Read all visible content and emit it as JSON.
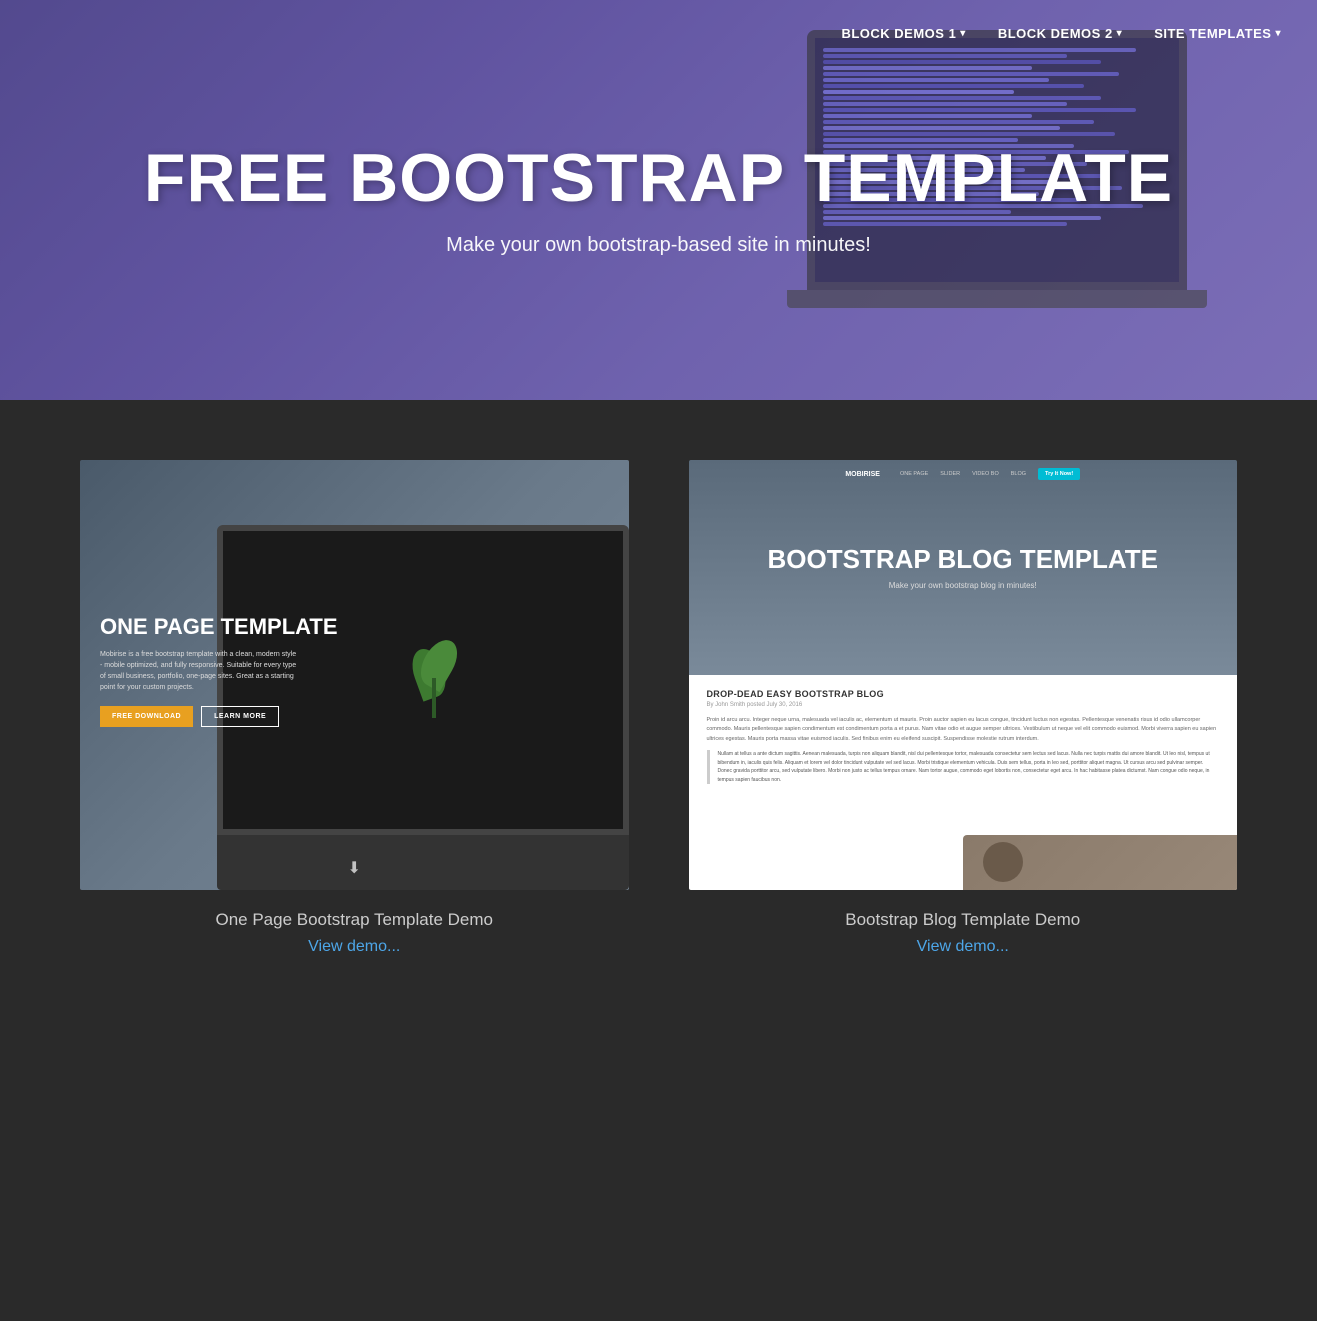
{
  "navbar": {
    "items": [
      {
        "label": "BLOCK DEMOS 1",
        "hasDropdown": true
      },
      {
        "label": "BLOCK DEMOS 2",
        "hasDropdown": true
      },
      {
        "label": "SITE TEMPLATES",
        "hasDropdown": true
      }
    ]
  },
  "hero": {
    "title": "FREE BOOTSTRAP TEMPLATE",
    "subtitle": "Make your own bootstrap-based site in minutes!"
  },
  "cards": [
    {
      "id": "onepage",
      "preview_heading": "ONE PAGE TEMPLATE",
      "preview_text": "Mobirise is a free bootstrap template with a clean, modern style - mobile optimized, and fully responsive. Suitable for every type of small business, portfolio, one-page sites. Great as a starting point for your custom projects.",
      "btn1": "FREE DOWNLOAD",
      "btn2": "LEARN MORE",
      "title": "One Page Bootstrap Template Demo",
      "link": "View demo..."
    },
    {
      "id": "blog",
      "preview_heading": "BOOTSTRAP BLOG TEMPLATE",
      "preview_subheading": "Make your own bootstrap blog in minutes!",
      "blog_nav_logo": "MOBIRISE",
      "blog_nav_links": [
        "ONE PAGE",
        "SLIDER",
        "VIDEO BO",
        "BLOG"
      ],
      "blog_try": "Try It Now!",
      "blog_post_title": "DROP-DEAD EASY BOOTSTRAP BLOG",
      "blog_post_meta": "By John Smith posted July 30, 2016",
      "blog_post_text1": "Proin id arcu arcu. Integer neque urna, malesuada vel iaculis ac, elementum ut mauris. Proin auctor sapien eu lacus congue, tincidunt luctus non egestas. Pellentesque venenatis risus id odio ullamcorper commodo. Mauris pellentesque sapien condimentum est condimentum porta a et purus. Nam vitae odio et augue semper ultrices. Vestibulum ut neque vel elit commodo euismod. Morbi viverra sapien eu sapien ultrices egestas. Mauris porta massa vitae euismod iaculis. Sed finibus enim eu eleifend suscipit. Suspendisse molestie rutrum interdum.",
      "blog_post_text2": "Nullam at tellus a ante dictum sagittis. Aenean malesuada, turpis non aliquam blandit, nisl dui pellentesque tortor, malesuada consectetur sem lectus sed lacus. Nulla nec turpis mattis dui amore blandit. Ut leo nisl, tempus ut bibendum in, iaculis quis felis. Aliquam et lorem vel dolor tincidunt vulputate vel sed lacus. Morbi tristique elementum vehicula. Duis sem tellus, porta in leo sed, porttitor aliquet magna. Ut cursus arcu sed pulvinar semper. Donec gravida porttitor arcu, sed vulputate libero. Morbi non justo ac tellus tempus ornare. Nam tortor augue, commodo eget lobortis non, consectetur eget arcu. In hac habitasse platea dictumst. Nam congue odio neque, in tempus sapien faucibus non.",
      "title": "Bootstrap Blog Template Demo",
      "link": "View demo..."
    }
  ]
}
